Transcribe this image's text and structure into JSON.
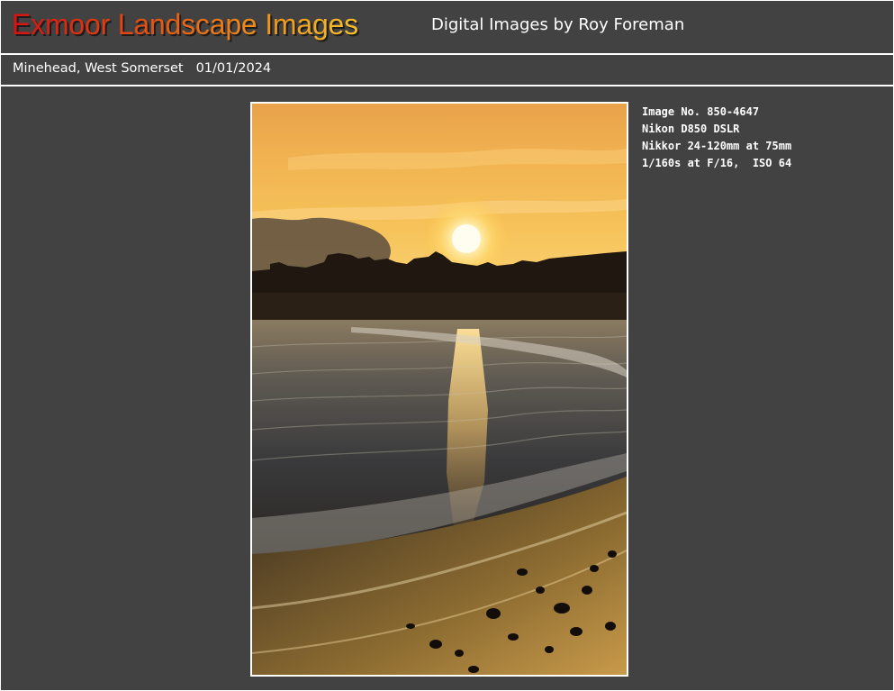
{
  "header": {
    "site_title": "Exmoor Landscape Images",
    "byline": "Digital Images by Roy Foreman"
  },
  "subheader": {
    "location": "Minehead, West Somerset",
    "date": "01/01/2024"
  },
  "photo": {
    "subject": "sunset over beach with waves and town silhouette"
  },
  "details": {
    "image_no": "Image No. 850-4647",
    "camera": "Nikon D850 DSLR",
    "lens": "Nikkor 24-120mm at 75mm",
    "exposure": "1/160s at F/16,  ISO 64"
  },
  "colors": {
    "background": "#424242",
    "title_gradient_start": "#d90f10",
    "title_gradient_end": "#f6c02a",
    "text": "#ffffff"
  }
}
